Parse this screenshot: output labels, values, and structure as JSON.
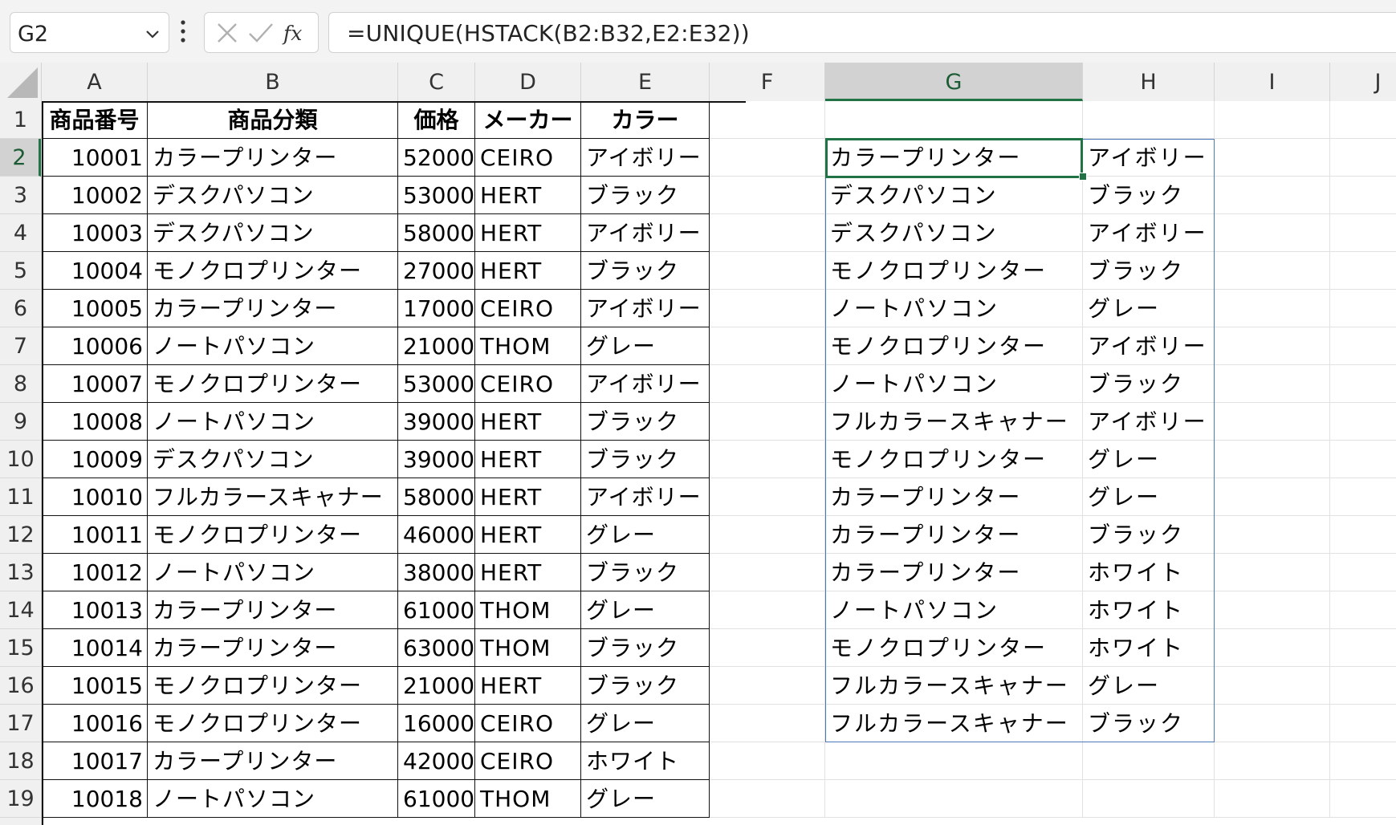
{
  "name_box": {
    "value": "G2"
  },
  "formula_bar": {
    "cancel_icon": "close-icon",
    "enter_icon": "check-icon",
    "fx_label": "fx",
    "formula": "=UNIQUE(HSTACK(B2:B32,E2:E32))"
  },
  "columns": [
    "A",
    "B",
    "C",
    "D",
    "E",
    "F",
    "G",
    "H",
    "I",
    "J"
  ],
  "selected_column": "G",
  "rows": [
    "1",
    "2",
    "3",
    "4",
    "5",
    "6",
    "7",
    "8",
    "9",
    "10",
    "11",
    "12",
    "13",
    "14",
    "15",
    "16",
    "17",
    "18",
    "19"
  ],
  "selected_row": "2",
  "table": {
    "headers": [
      "商品番号",
      "商品分類",
      "価格",
      "メーカー",
      "カラー"
    ],
    "rows": [
      [
        "10001",
        "カラープリンター",
        "52000",
        "CEIRO",
        "アイボリー"
      ],
      [
        "10002",
        "デスクパソコン",
        "53000",
        "HERT",
        "ブラック"
      ],
      [
        "10003",
        "デスクパソコン",
        "58000",
        "HERT",
        "アイボリー"
      ],
      [
        "10004",
        "モノクロプリンター",
        "27000",
        "HERT",
        "ブラック"
      ],
      [
        "10005",
        "カラープリンター",
        "17000",
        "CEIRO",
        "アイボリー"
      ],
      [
        "10006",
        "ノートパソコン",
        "21000",
        "THOM",
        "グレー"
      ],
      [
        "10007",
        "モノクロプリンター",
        "53000",
        "CEIRO",
        "アイボリー"
      ],
      [
        "10008",
        "ノートパソコン",
        "39000",
        "HERT",
        "ブラック"
      ],
      [
        "10009",
        "デスクパソコン",
        "39000",
        "HERT",
        "ブラック"
      ],
      [
        "10010",
        "フルカラースキャナー",
        "58000",
        "HERT",
        "アイボリー"
      ],
      [
        "10011",
        "モノクロプリンター",
        "46000",
        "HERT",
        "グレー"
      ],
      [
        "10012",
        "ノートパソコン",
        "38000",
        "HERT",
        "ブラック"
      ],
      [
        "10013",
        "カラープリンター",
        "61000",
        "THOM",
        "グレー"
      ],
      [
        "10014",
        "カラープリンター",
        "63000",
        "THOM",
        "ブラック"
      ],
      [
        "10015",
        "モノクロプリンター",
        "21000",
        "HERT",
        "ブラック"
      ],
      [
        "10016",
        "モノクロプリンター",
        "16000",
        "CEIRO",
        "グレー"
      ],
      [
        "10017",
        "カラープリンター",
        "42000",
        "CEIRO",
        "ホワイト"
      ],
      [
        "10018",
        "ノートパソコン",
        "61000",
        "THOM",
        "グレー"
      ]
    ]
  },
  "spill": {
    "rows": [
      [
        "カラープリンター",
        "アイボリー"
      ],
      [
        "デスクパソコン",
        "ブラック"
      ],
      [
        "デスクパソコン",
        "アイボリー"
      ],
      [
        "モノクロプリンター",
        "ブラック"
      ],
      [
        "ノートパソコン",
        "グレー"
      ],
      [
        "モノクロプリンター",
        "アイボリー"
      ],
      [
        "ノートパソコン",
        "ブラック"
      ],
      [
        "フルカラースキャナー",
        "アイボリー"
      ],
      [
        "モノクロプリンター",
        "グレー"
      ],
      [
        "カラープリンター",
        "グレー"
      ],
      [
        "カラープリンター",
        "ブラック"
      ],
      [
        "カラープリンター",
        "ホワイト"
      ],
      [
        "ノートパソコン",
        "ホワイト"
      ],
      [
        "モノクロプリンター",
        "ホワイト"
      ],
      [
        "フルカラースキャナー",
        "グレー"
      ],
      [
        "フルカラースキャナー",
        "ブラック"
      ]
    ]
  },
  "colors": {
    "accent": "#217346",
    "spill_border": "#4a78b8",
    "header_bg": "#f0f0f0"
  }
}
